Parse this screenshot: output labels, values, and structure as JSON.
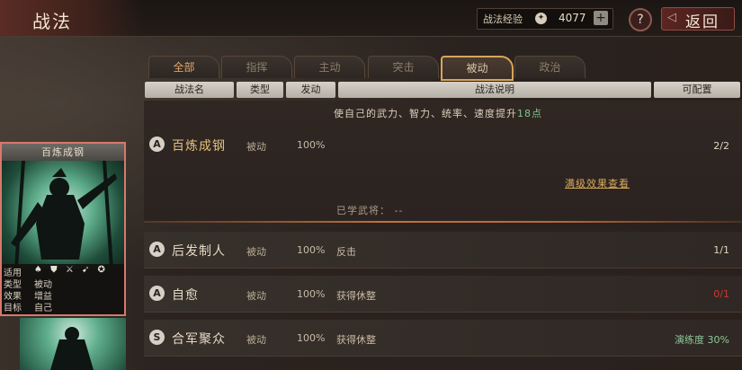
{
  "topbar": {
    "title": "战法",
    "exp_label": "战法经验",
    "exp_icon": "✦",
    "exp_value": "4077",
    "plus_label": "+",
    "help_label": "?",
    "back_label": "返回"
  },
  "tabs": [
    {
      "label": "全部"
    },
    {
      "label": "指挥"
    },
    {
      "label": "主动"
    },
    {
      "label": "突击"
    },
    {
      "label": "被动",
      "active": true
    },
    {
      "label": "政治"
    }
  ],
  "columns": [
    "战法名",
    "类型",
    "发动",
    "战法说明",
    "可配置"
  ],
  "tactics": [
    {
      "grade": "A",
      "name": "百炼成钢",
      "type": "被动",
      "trigger": "100%",
      "config": "2/2",
      "description_prefix": "使自己的武力、智力、统率、速度提升",
      "description_value": "18点",
      "full_effect_link": "满级效果查看",
      "learned_label": "已学武将：",
      "learned_value": "--"
    },
    {
      "grade": "A",
      "name": "后发制人",
      "type": "被动",
      "trigger": "100%",
      "desc": "反击",
      "config": "1/1"
    },
    {
      "grade": "A",
      "name": "自愈",
      "type": "被动",
      "trigger": "100%",
      "desc": "获得休整",
      "config": "0/1"
    },
    {
      "grade": "S",
      "name": "合军聚众",
      "type": "被动",
      "trigger": "100%",
      "desc": "获得休整",
      "config": "演练度 30%"
    }
  ],
  "card": {
    "title": "百炼成钢",
    "suitable_label": "适用",
    "troop_icons": "♠ ⛊ ⚔ ➹ ✪",
    "type_label": "类型",
    "type_value": "被动",
    "effect_label": "效果",
    "effect_value": "增益",
    "target_label": "目标",
    "target_value": "自己"
  },
  "colors": {
    "accent": "#d7a55e",
    "selected_border": "#d8796b",
    "green_text": "#8ec89a",
    "red_text": "#c83c30"
  }
}
